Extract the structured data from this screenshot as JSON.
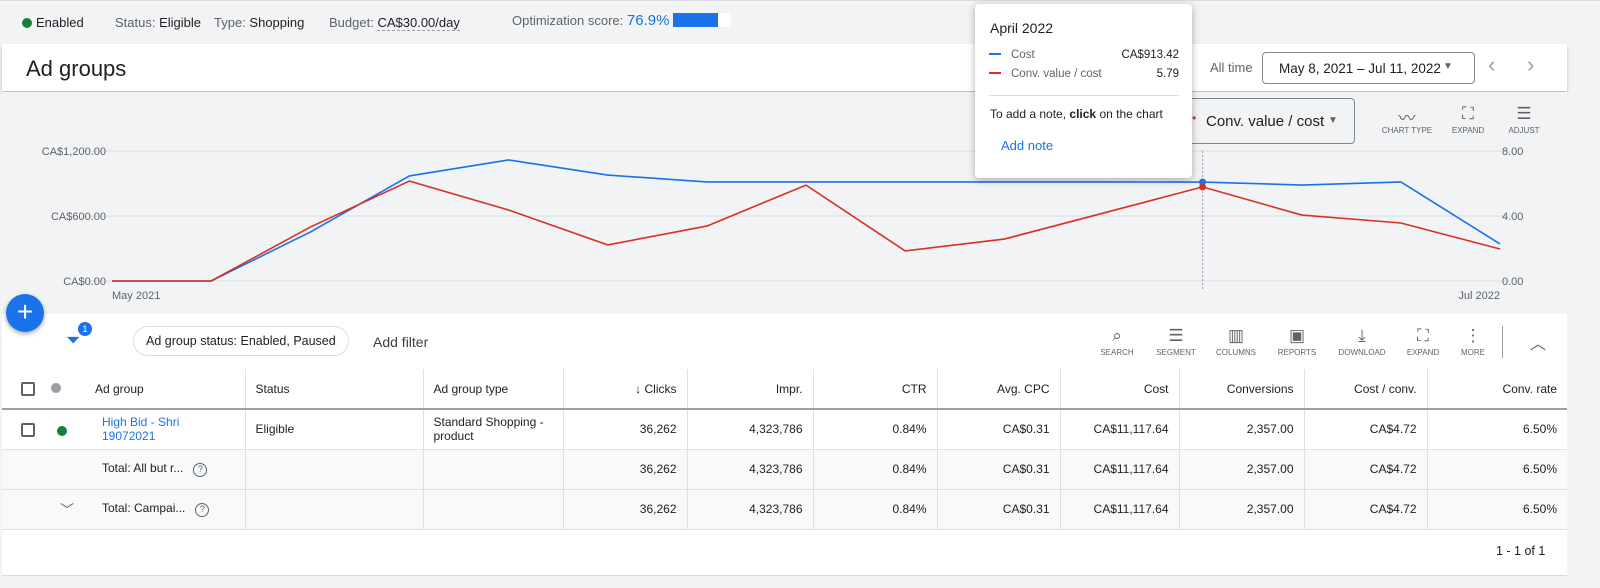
{
  "summary": {
    "enabled": "Enabled",
    "status_label": "Status:",
    "status": "Eligible",
    "type_label": "Type:",
    "type": "Shopping",
    "budget_label": "Budget:",
    "budget": "CA$30.00/day",
    "opt_label": "Optimization score:",
    "opt_score": "76.9%",
    "opt_fraction": 0.769
  },
  "header": {
    "title": "Ad groups",
    "all_time": "All time",
    "date_range": "May 8, 2021 – Jul 11, 2022"
  },
  "chart_controls": {
    "metric2": "Conv. value / cost",
    "chart_type": "CHART TYPE",
    "expand": "EXPAND",
    "adjust": "ADJUST"
  },
  "tooltip": {
    "title": "April 2022",
    "rows": [
      {
        "label": "Cost",
        "value": "CA$913.42",
        "color": "#1a73e8"
      },
      {
        "label": "Conv. value / cost",
        "value": "5.79",
        "color": "#d93025"
      }
    ],
    "note_pre": "To add a note, ",
    "note_bold": "click",
    "note_post": " on the chart",
    "add_note": "Add note"
  },
  "chart_data": {
    "type": "line",
    "x": [
      "May 2021",
      "Jun 2021",
      "Jul 2021",
      "Aug 2021",
      "Sep 2021",
      "Oct 2021",
      "Nov 2021",
      "Dec 2021",
      "Jan 2022",
      "Feb 2022",
      "Mar 2022",
      "Apr 2022",
      "May 2022",
      "Jun 2022",
      "Jul 2022"
    ],
    "x_tick_labels": [
      "May 2021",
      "Jul 2022"
    ],
    "left_axis": {
      "ticks": [
        "CA$0.00",
        "CA$600.00",
        "CA$1,200.00"
      ],
      "range": [
        0,
        1200
      ]
    },
    "right_axis": {
      "ticks": [
        "0.00",
        "4.00",
        "8.00"
      ],
      "range": [
        0,
        8
      ]
    },
    "series": [
      {
        "name": "Cost",
        "axis": "left",
        "color": "#1a73e8",
        "values": [
          0,
          0,
          452,
          970,
          1117,
          978,
          914,
          914,
          914,
          914,
          914,
          913.42,
          886,
          914,
          342
        ]
      },
      {
        "name": "Conv. value / cost",
        "axis": "right",
        "color": "#d93025",
        "values": [
          0,
          0,
          3.32,
          6.15,
          4.37,
          2.22,
          3.38,
          5.9,
          1.85,
          2.58,
          4.18,
          5.79,
          4.06,
          3.57,
          1.97
        ]
      }
    ],
    "highlight_index": 11
  },
  "filters": {
    "badge": "1",
    "chip": "Ad group status: Enabled, Paused",
    "add_filter": "Add filter"
  },
  "toolbar": [
    "SEARCH",
    "SEGMENT",
    "COLUMNS",
    "REPORTS",
    "DOWNLOAD",
    "EXPAND",
    "MORE"
  ],
  "table": {
    "headers": [
      "Ad group",
      "Status",
      "Ad group type",
      "Clicks",
      "Impr.",
      "CTR",
      "Avg. CPC",
      "Cost",
      "Conversions",
      "Cost / conv.",
      "Conv. rate"
    ],
    "rows": [
      {
        "name": "High Bid - Shri 19072021",
        "status": "Eligible",
        "type": "Standard Shopping - product",
        "cells": [
          "36,262",
          "4,323,786",
          "0.84%",
          "CA$0.31",
          "CA$11,117.64",
          "2,357.00",
          "CA$4.72",
          "6.50%"
        ]
      }
    ],
    "totals": [
      {
        "name": "Total: All but r...",
        "cells": [
          "36,262",
          "4,323,786",
          "0.84%",
          "CA$0.31",
          "CA$11,117.64",
          "2,357.00",
          "CA$4.72",
          "6.50%"
        ]
      },
      {
        "name": "Total: Campai...",
        "cells": [
          "36,262",
          "4,323,786",
          "0.84%",
          "CA$0.31",
          "CA$11,117.64",
          "2,357.00",
          "CA$4.72",
          "6.50%"
        ]
      }
    ],
    "pagination": "1 - 1 of 1"
  }
}
